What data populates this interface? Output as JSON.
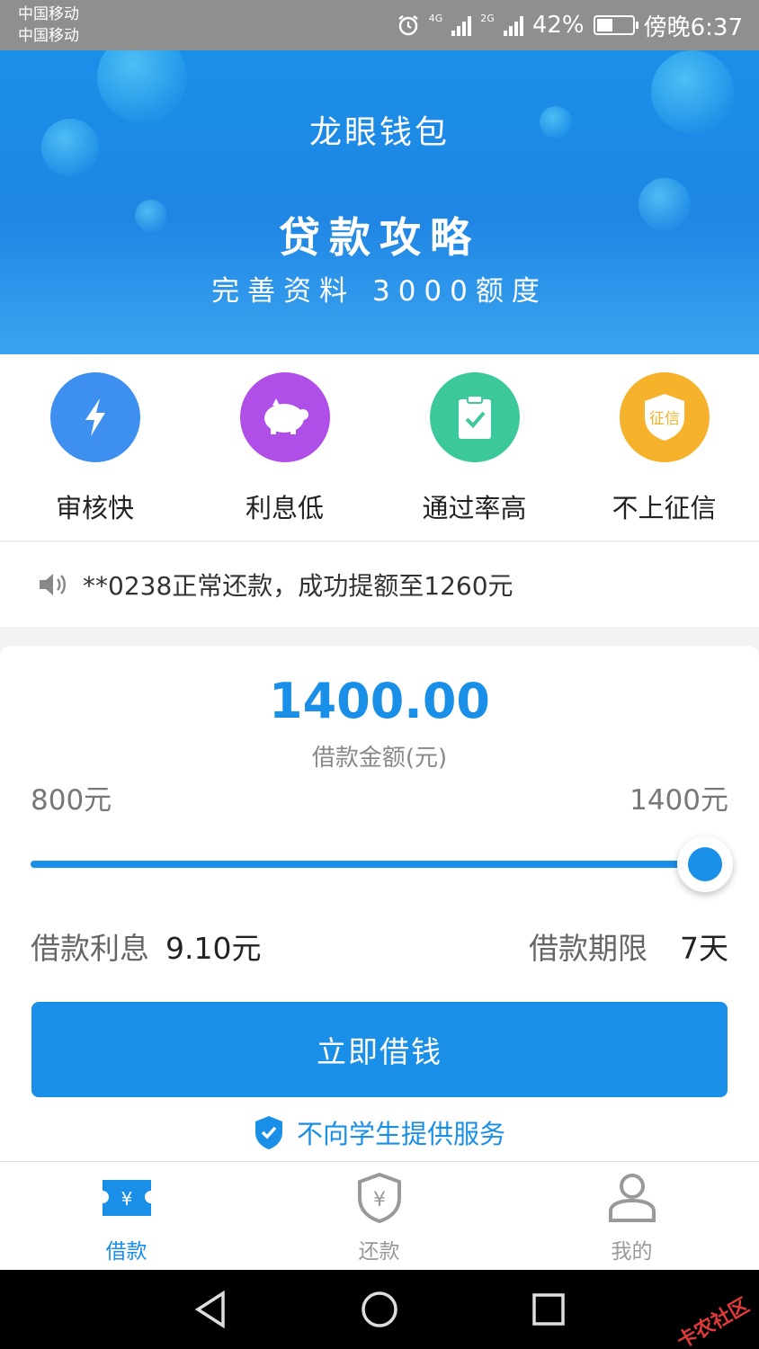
{
  "status_bar": {
    "carrier_1": "中国移动",
    "carrier_2": "中国移动",
    "network_1": "4G",
    "network_2": "2G",
    "battery_percent": "42%",
    "time": "傍晚6:37"
  },
  "banner": {
    "app_title": "龙眼钱包",
    "headline": "贷款攻略",
    "subline": "完善资料 3000额度"
  },
  "features": [
    {
      "label": "审核快",
      "icon": "lightning-icon",
      "color": "#3d8ff0"
    },
    {
      "label": "利息低",
      "icon": "piggy-bank-icon",
      "color": "#b04ee8"
    },
    {
      "label": "通过率高",
      "icon": "clipboard-check-icon",
      "color": "#3cc89a"
    },
    {
      "label": "不上征信",
      "icon": "credit-shield-icon",
      "color": "#f7b22b",
      "icon_text": "征信"
    }
  ],
  "notice": {
    "icon": "speaker-icon",
    "text": "**0238正常还款，成功提额至1260元"
  },
  "loan": {
    "amount": "1400.00",
    "amount_label": "借款金额(元)",
    "min_label": "800元",
    "max_label": "1400元",
    "slider_fraction": 1.0,
    "interest_label": "借款利息",
    "interest_value": "9.10元",
    "term_label": "借款期限",
    "term_value": "7天",
    "borrow_button": "立即借钱",
    "student_note": "不向学生提供服务"
  },
  "tabs": [
    {
      "label": "借款",
      "icon": "ticket-yen-icon",
      "active": true
    },
    {
      "label": "还款",
      "icon": "shield-yen-icon",
      "active": false
    },
    {
      "label": "我的",
      "icon": "person-icon",
      "active": false
    }
  ],
  "watermark": "卡农社区",
  "colors": {
    "accent": "#1a8fe8",
    "status_bar": "#8f8f8f"
  }
}
